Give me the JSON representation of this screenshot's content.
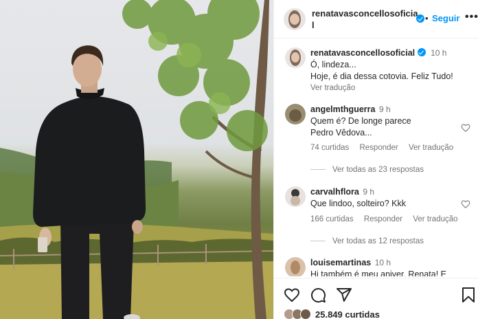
{
  "header": {
    "username_line1": "renatavasconcellosoficia",
    "username_line2": "l",
    "separator": "•",
    "follow_label": "Seguir",
    "more_label": "•••"
  },
  "post": {
    "username": "renatavasconcellosoficial",
    "time": "10 h",
    "caption_line1": "Ó, lindeza...",
    "caption_line2": "Hoje, é dia dessa cotovia. Feliz Tudo!",
    "translate_label": "Ver tradução"
  },
  "comments": [
    {
      "username": "angelmthguerra",
      "time": "9 h",
      "text": "Quem é? De longe parece Pedro Vêdova...",
      "likes": "74 curtidas",
      "reply_label": "Responder",
      "translate_label": "Ver tradução",
      "replies_label": "Ver todas as 23 respostas"
    },
    {
      "username": "carvalhflora",
      "time": "9 h",
      "text": "Que lindoo, solteiro? Kkk",
      "likes": "166 curtidas",
      "reply_label": "Responder",
      "translate_label": "Ver tradução",
      "replies_label": "Ver todas as 12 respostas"
    },
    {
      "username": "louisemartinas",
      "time": "10 h",
      "text": "Hj também é meu aniver, Renata! E"
    }
  ],
  "footer": {
    "likes_count": "25.849 curtidas"
  },
  "colors": {
    "accent": "#0095f6",
    "text": "#262626",
    "muted": "#737373"
  },
  "icons": [
    "heart-icon",
    "comment-icon",
    "share-icon",
    "bookmark-icon",
    "verified-badge-icon",
    "more-options-icon"
  ]
}
